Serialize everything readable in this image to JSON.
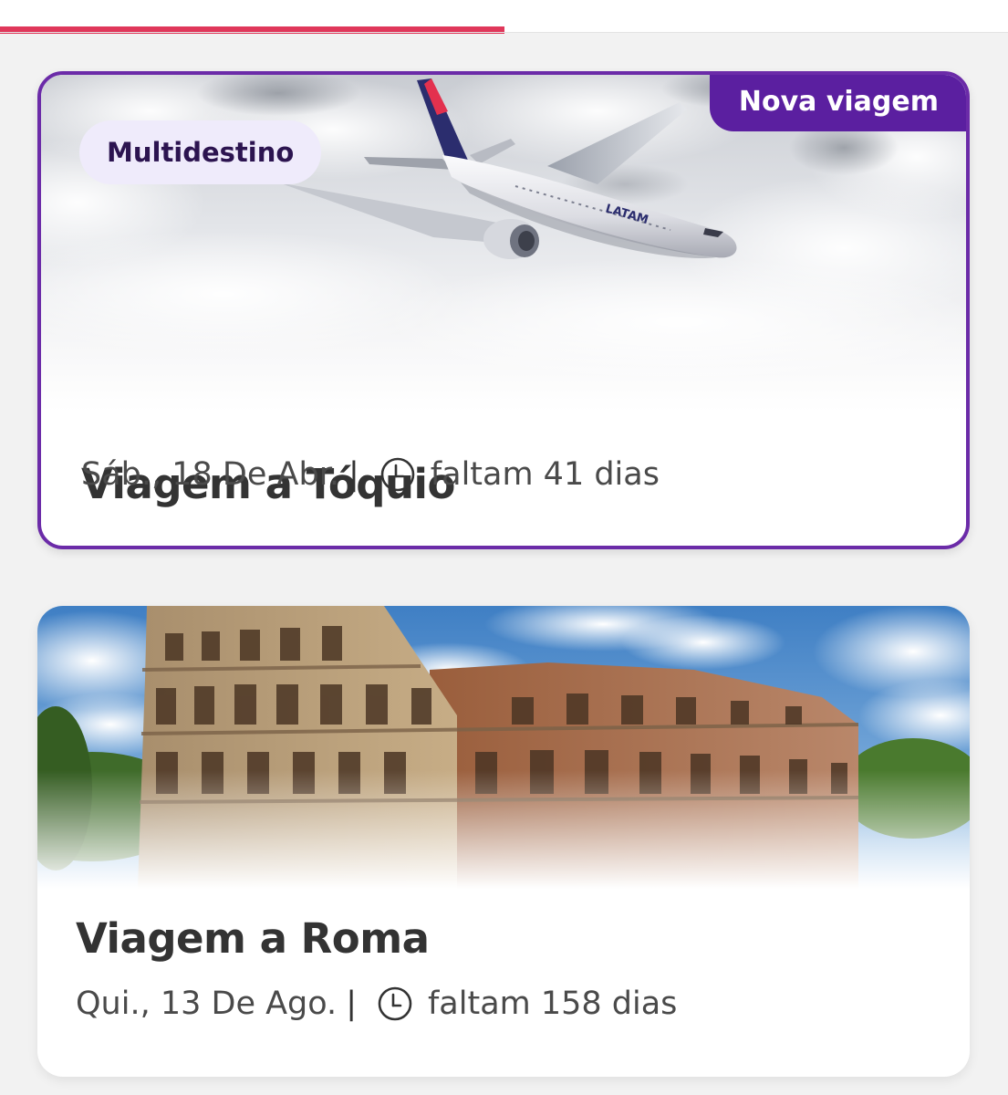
{
  "progress": {
    "fraction": 0.5,
    "color": "#e0375a"
  },
  "trips": [
    {
      "badge": "Nova viagem",
      "chip": "Multidestino",
      "title": "Viagem a Tóquio",
      "date": "Sáb., 18 De Abr.",
      "separator": "|",
      "countdown": "faltam 41 dias",
      "image": "airplane-in-clouds",
      "airline_mark": "LATAM",
      "icon": "clock-icon"
    },
    {
      "title": "Viagem a Roma",
      "date": "Qui., 13 De Ago.",
      "separator": "|",
      "countdown": "faltam 158 dias",
      "image": "colosseum",
      "icon": "clock-icon"
    }
  ],
  "colors": {
    "accent_purple": "#5b1fa0",
    "card_border": "#6b2ba8",
    "chip_bg": "#efebfb",
    "chip_text": "#2c1450",
    "title_text": "#333333"
  }
}
